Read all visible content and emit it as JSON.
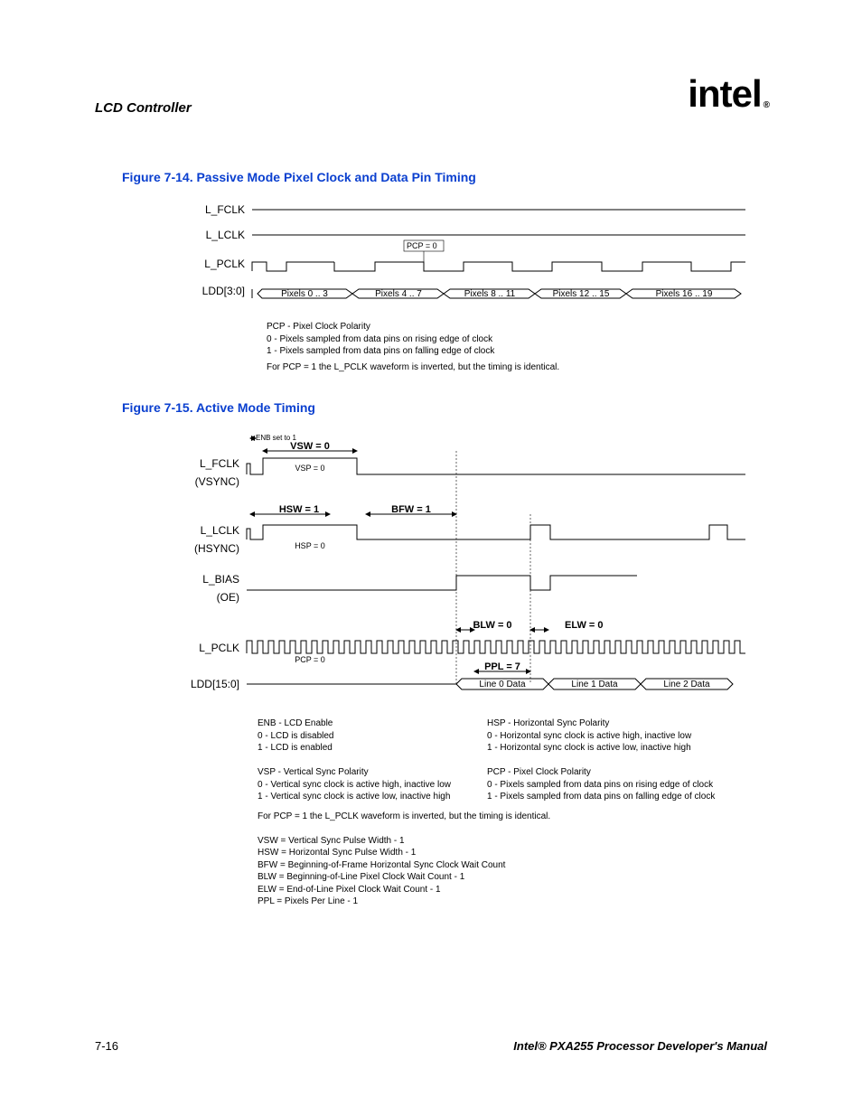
{
  "header": {
    "title": "LCD Controller",
    "logo_text": "intel",
    "logo_reg": "®"
  },
  "fig14": {
    "caption": "Figure 7-14. Passive Mode Pixel Clock and Data Pin Timing",
    "signals": {
      "fclk": "L_FCLK",
      "lclk": "L_LCLK",
      "pclk": "L_PCLK",
      "ldd": "LDD[3:0]"
    },
    "pcp_label": "PCP = 0",
    "data_cells": [
      "Pixels 0 .. 3",
      "Pixels 4 .. 7",
      "Pixels 8 .. 11",
      "Pixels 12 .. 15",
      "Pixels 16 .. 19"
    ],
    "legend": [
      "PCP - Pixel Clock Polarity",
      " 0 - Pixels sampled from data pins on rising edge of clock",
      " 1 - Pixels sampled from data pins on falling edge of clock",
      "For PCP = 1 the L_PCLK waveform is inverted, but the timing is identical."
    ]
  },
  "fig15": {
    "caption": "Figure 7-15. Active Mode Timing",
    "signals": {
      "fclk": "L_FCLK",
      "fclk_sub": "(VSYNC)",
      "lclk": "L_LCLK",
      "lclk_sub": "(HSYNC)",
      "lbias": "L_BIAS",
      "lbias_sub": "(OE)",
      "pclk": "L_PCLK",
      "ldd": "LDD[15:0]"
    },
    "annotations": {
      "enb": "ENB set to 1",
      "vsw": "VSW = 0",
      "vsp": "VSP = 0",
      "hsw": "HSW = 1",
      "bfw": "BFW = 1",
      "hsp": "HSP = 0",
      "blw": "BLW = 0",
      "elw": "ELW = 0",
      "pcp": "PCP = 0",
      "ppl": "PPL = 7"
    },
    "data_cells": [
      "Line 0 Data",
      "Line 1 Data",
      "Line 2 Data"
    ],
    "legend_left": [
      "ENB - LCD Enable",
      " 0 - LCD is disabled",
      " 1 - LCD is enabled",
      "",
      "VSP - Vertical Sync Polarity",
      " 0 - Vertical sync clock is active high, inactive low",
      " 1 - Vertical sync clock is active low, inactive high"
    ],
    "legend_right": [
      "HSP - Horizontal Sync Polarity",
      " 0 - Horizontal sync clock is active high, inactive low",
      " 1 - Horizontal sync clock is active low, inactive high",
      "",
      "PCP - Pixel Clock Polarity",
      " 0 - Pixels sampled from data pins on rising edge of clock",
      " 1 - Pixels sampled from data pins on falling edge of clock"
    ],
    "legend_bottom": [
      "For PCP = 1 the L_PCLK waveform is inverted, but the timing is identical.",
      "",
      "VSW = Vertical Sync Pulse Width - 1",
      "HSW = Horizontal Sync Pulse Width - 1",
      "BFW = Beginning-of-Frame Horizontal Sync Clock Wait Count",
      "BLW = Beginning-of-Line Pixel Clock Wait Count - 1",
      "ELW = End-of-Line Pixel Clock Wait Count - 1",
      "PPL = Pixels Per Line - 1"
    ]
  },
  "footer": {
    "left": "7-16",
    "right": "Intel® PXA255 Processor Developer's Manual"
  }
}
